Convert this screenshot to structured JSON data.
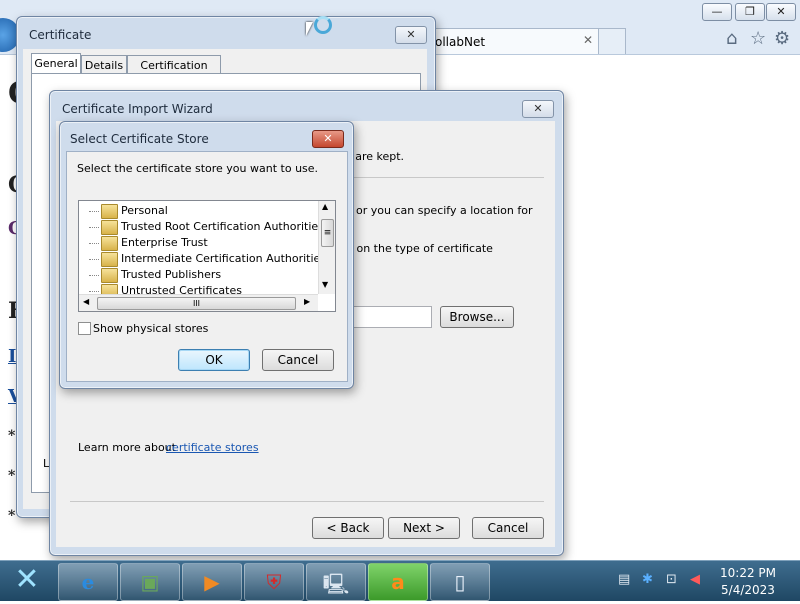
{
  "browser": {
    "tab_title": "ollabNet",
    "tab_close": "✕",
    "win_minimize": "—",
    "win_restore": "❐",
    "win_close": "✕",
    "icons": {
      "home": "home-icon",
      "favorites": "star-icon",
      "tools": "gear-icon"
    }
  },
  "background_page": {
    "fragments": [
      "C",
      "C",
      "C",
      "F",
      "I",
      "V",
      "*",
      "*",
      "*"
    ]
  },
  "cert_dialog": {
    "title": "Certificate",
    "close": "✕",
    "tabs": [
      "General",
      "Details",
      "Certification Path"
    ],
    "fragment_le": "Le"
  },
  "wizard": {
    "title": "Certificate Import Wizard",
    "close": "✕",
    "text_kept": "s are kept.",
    "text_specify": "or you can specify a location for",
    "text_type": "d on the type of certificate",
    "browse_label": "Browse...",
    "learn_more_prefix": "Learn more about ",
    "learn_more_link": "certificate stores",
    "back_label": "< Back",
    "next_label": "Next >",
    "cancel_label": "Cancel"
  },
  "store_dialog": {
    "title": "Select Certificate Store",
    "close": "✕",
    "instruction": "Select the certificate store you want to use.",
    "stores": [
      "Personal",
      "Trusted Root Certification Authorities",
      "Enterprise Trust",
      "Intermediate Certification Authorities",
      "Trusted Publishers",
      "Untrusted Certificates"
    ],
    "show_physical_label": "Show physical stores",
    "show_physical_checked": false,
    "ok_label": "OK",
    "cancel_label": "Cancel",
    "hscroll_grip": "III",
    "vscroll_grip": "≡"
  },
  "taskbar": {
    "items": [
      "start-icon",
      "internet-explorer-icon",
      "photo-viewer-icon",
      "media-player-icon",
      "security-shield-icon",
      "computer-icon",
      "avast-icon",
      "document-icon"
    ],
    "time": "10:22 PM",
    "date": "5/4/2023"
  }
}
